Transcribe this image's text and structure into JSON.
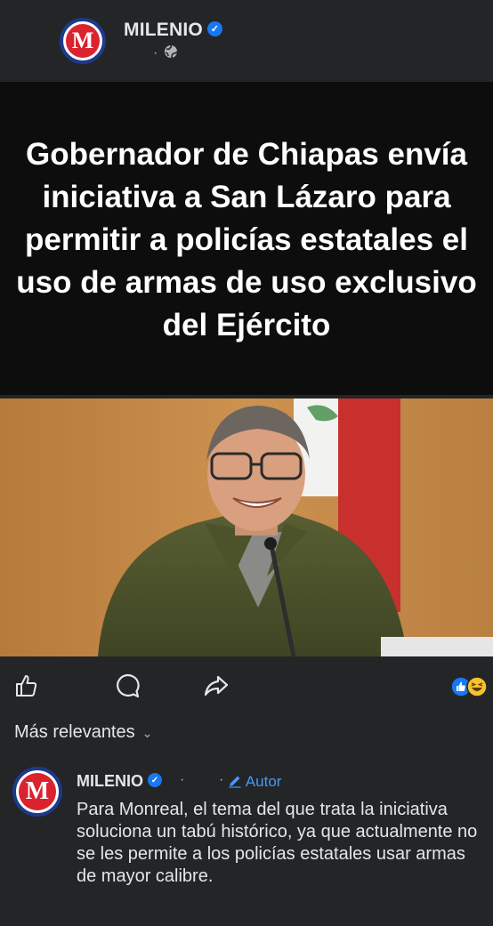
{
  "post": {
    "page_name": "MILENIO",
    "meta_separator": "·",
    "audience_icon": "globe-icon",
    "headline": "Gobernador de Chiapas envía iniciativa a San Lázaro para permitir a policías estatales el uso de armas  de uso exclusivo del Ejército"
  },
  "actions": {
    "like_icon": "thumbs-up-icon",
    "comment_icon": "comment-icon",
    "share_icon": "share-icon",
    "reaction_icons": [
      "like-reaction-icon",
      "haha-reaction-icon"
    ]
  },
  "comments": {
    "sort_label": "Más relevantes",
    "items": [
      {
        "author": "MILENIO",
        "separator": "·",
        "author_badge": "Autor",
        "text": "Para Monreal, el tema del que trata la iniciativa soluciona un tabú histórico, ya que actualmente no se les permite a los policías estatales usar armas de mayor calibre."
      }
    ]
  },
  "colors": {
    "background": "#242526",
    "headline_bg": "#0d0d0d",
    "brand_red": "#d9232e",
    "verified_blue": "#1877f2",
    "link_blue": "#4599ff"
  }
}
